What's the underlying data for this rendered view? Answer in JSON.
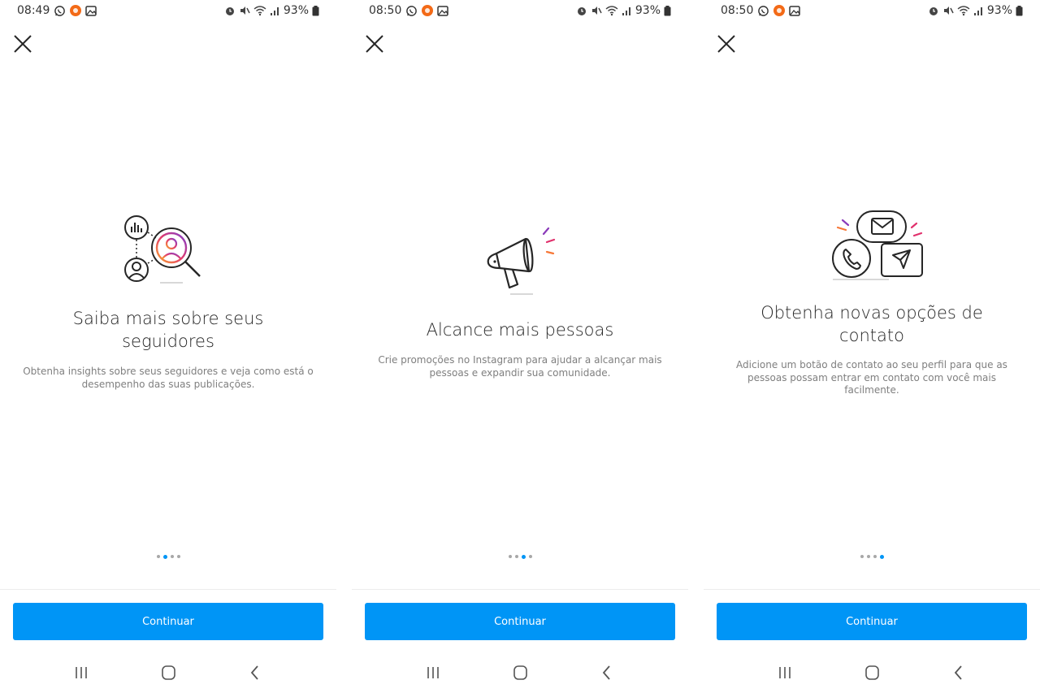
{
  "accent_color": "#0095f6",
  "panels": [
    {
      "status": {
        "time": "08:49",
        "battery": "93%"
      },
      "title": "Saiba mais sobre seus seguidores",
      "subtitle": "Obtenha insights sobre seus seguidores e veja como está o desempenho das suas publicações.",
      "illustration": "followers-insights-illustration",
      "active_page": 2,
      "total_pages": 4,
      "cta": "Continuar"
    },
    {
      "status": {
        "time": "08:50",
        "battery": "93%"
      },
      "title": "Alcance mais pessoas",
      "subtitle": "Crie promoções no Instagram para ajudar a alcançar mais pessoas e expandir sua comunidade.",
      "illustration": "megaphone-illustration",
      "active_page": 3,
      "total_pages": 4,
      "cta": "Continuar"
    },
    {
      "status": {
        "time": "08:50",
        "battery": "93%"
      },
      "title": "Obtenha novas opções de contato",
      "subtitle": "Adicione um botão de contato ao seu perfil para que as pessoas possam entrar em contato com você mais facilmente.",
      "illustration": "contact-options-illustration",
      "active_page": 4,
      "total_pages": 4,
      "cta": "Continuar"
    }
  ]
}
